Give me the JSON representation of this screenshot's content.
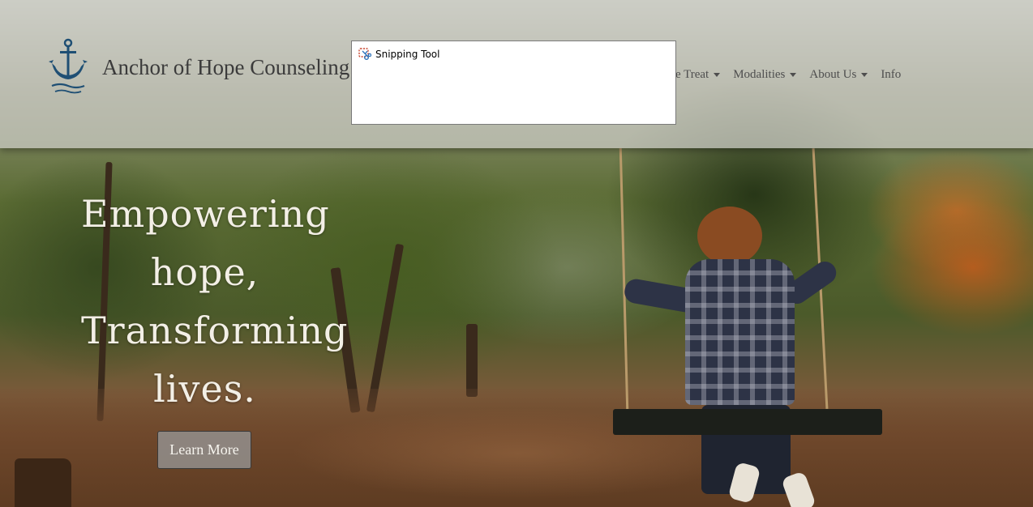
{
  "header": {
    "brand_title": "Anchor of Hope Counseling",
    "logo_icon": "anchor-icon",
    "nav": [
      {
        "label": "We Treat",
        "has_dropdown": true
      },
      {
        "label": "Modalities",
        "has_dropdown": true
      },
      {
        "label": "About Us",
        "has_dropdown": true
      },
      {
        "label": "Info",
        "has_dropdown": false
      }
    ]
  },
  "hero": {
    "headline_lines": [
      "Empowering",
      "hope,",
      "Transforming",
      "lives."
    ],
    "cta_label": "Learn More"
  },
  "popup": {
    "title": "Snipping Tool",
    "icon": "scissors-icon"
  },
  "colors": {
    "header_overlay": "#cdcdc8",
    "brand_text": "#3b3b3b",
    "hero_text": "#f3efe6",
    "anchor_blue": "#1f4f74"
  }
}
